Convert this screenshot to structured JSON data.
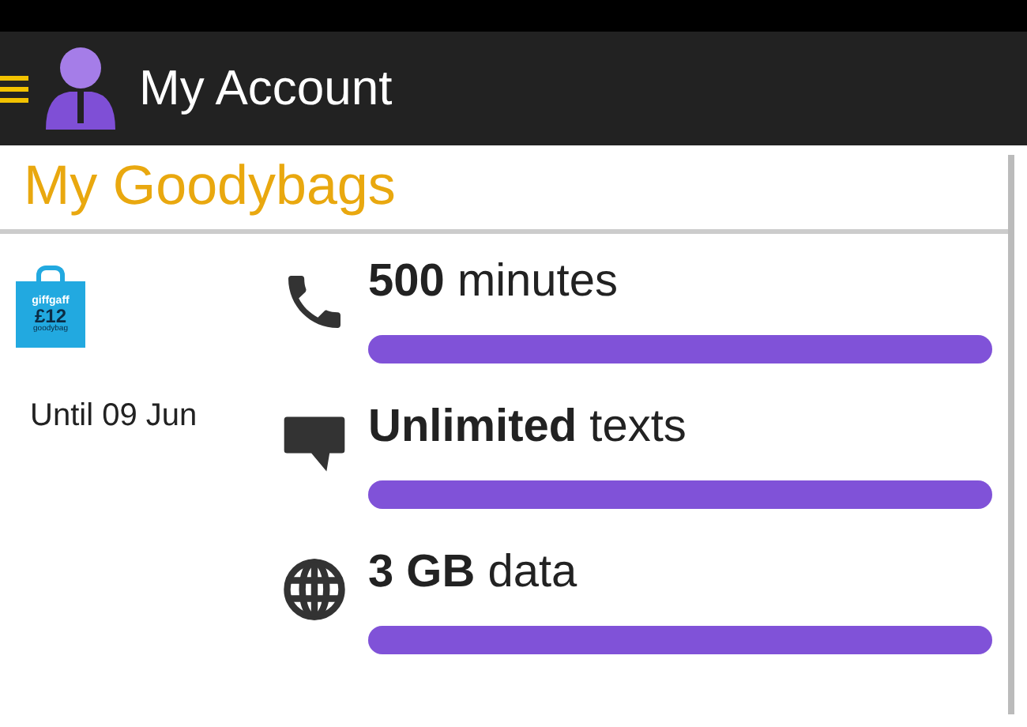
{
  "app_bar": {
    "title": "My Account"
  },
  "section": {
    "title": "My Goodybags"
  },
  "goodybag": {
    "brand": "giffgaff",
    "price": "£12",
    "label": "goodybag",
    "expiry": "Until 09 Jun"
  },
  "allowances": [
    {
      "kind": "calls",
      "text": "**500** minutes",
      "level": 1
    },
    {
      "kind": "texts",
      "text": "**Unlimited** texts",
      "level": 1
    },
    {
      "kind": "data",
      "text": "**3 GB** data",
      "level": 1
    }
  ]
}
